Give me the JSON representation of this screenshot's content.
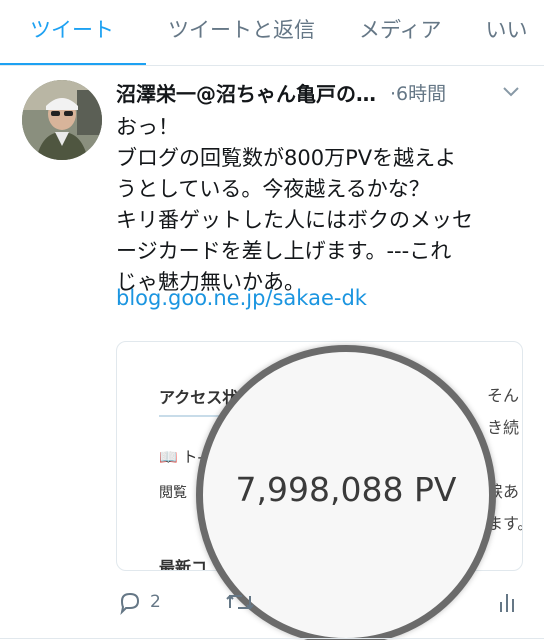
{
  "tabs": [
    {
      "label": "ツイート",
      "active": true
    },
    {
      "label": "ツイートと返信",
      "active": false
    },
    {
      "label": "メディア",
      "active": false
    },
    {
      "label": "いい",
      "active": false
    }
  ],
  "tweet": {
    "author_name": "沼澤栄一@沼ちゃん亀戸の…",
    "time": "·6時間",
    "lines": [
      "おっ！",
      "ブログの回覧数が800万PVを越えよ",
      "うとしている。今夜越えるかな？",
      "キリ番ゲットした人にはボクのメッセ",
      "ージカードを差し上げます。---これ",
      "じゃ魅力無いかあ。"
    ],
    "link": "blog.goo.ne.jp/sakae-dk"
  },
  "card": {
    "title": "アクセス状",
    "toppage": "📖 ト-",
    "browse": "閲覧",
    "latest": "最新コ",
    "right_lines": [
      "そん",
      "き続",
      "涙あ",
      "ます。"
    ]
  },
  "magnifier": {
    "pv_value": "7,998,088 PV"
  },
  "actions": {
    "reply_count": "2"
  },
  "colors": {
    "accent": "#1da1f2",
    "link": "#1b95e0",
    "muted": "#657786"
  }
}
